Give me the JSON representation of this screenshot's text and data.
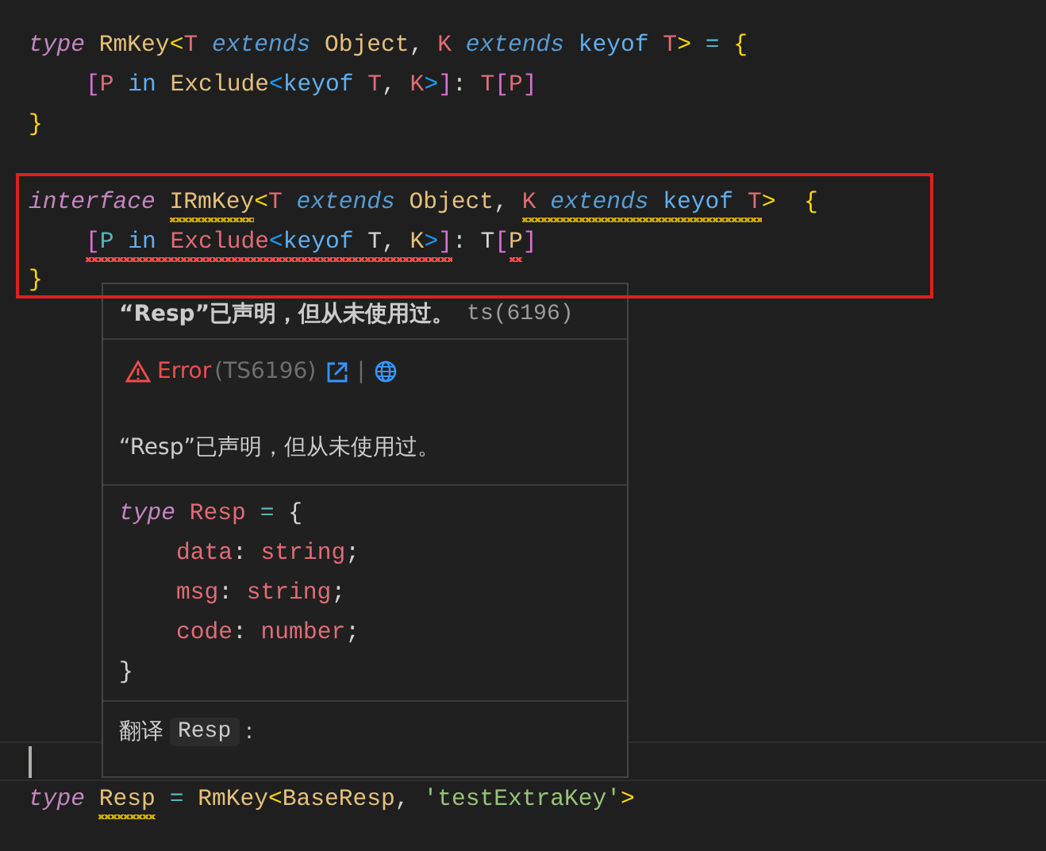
{
  "code_top": [
    {
      "indented": false,
      "segments": [
        {
          "tokens": [
            {
              "text": "type",
              "kind": "keyword"
            },
            {
              "text": " RmKey",
              "kind": "typename"
            },
            {
              "text": "<",
              "kind": "bracket1"
            },
            {
              "text": "T",
              "kind": "param"
            },
            {
              "text": " extends",
              "kind": "modifier"
            },
            {
              "text": " Object",
              "kind": "typename"
            },
            {
              "text": ",",
              "kind": "plain"
            },
            {
              "text": " K",
              "kind": "param"
            },
            {
              "text": " extends",
              "kind": "modifier"
            },
            {
              "text": " keyof",
              "kind": "keyof"
            },
            {
              "text": " T",
              "kind": "param"
            },
            {
              "text": ">",
              "kind": "bracket1"
            },
            {
              "text": " =",
              "kind": "operator"
            },
            {
              "text": " {",
              "kind": "bracket1"
            }
          ]
        }
      ]
    },
    {
      "indented": true,
      "segments": [
        {
          "tokens": [
            {
              "text": "[",
              "kind": "bracket2"
            },
            {
              "text": "P",
              "kind": "param"
            },
            {
              "text": " in",
              "kind": "keyof"
            },
            {
              "text": " Exclude",
              "kind": "typename"
            },
            {
              "text": "<",
              "kind": "bracket3"
            },
            {
              "text": "keyof",
              "kind": "keyof"
            },
            {
              "text": " T",
              "kind": "param"
            },
            {
              "text": ",",
              "kind": "plain"
            },
            {
              "text": " K",
              "kind": "param"
            },
            {
              "text": ">",
              "kind": "bracket3"
            },
            {
              "text": "]",
              "kind": "bracket2"
            },
            {
              "text": ":",
              "kind": "plain"
            },
            {
              "text": " T",
              "kind": "param"
            },
            {
              "text": "[",
              "kind": "bracket2"
            },
            {
              "text": "P",
              "kind": "param"
            },
            {
              "text": "]",
              "kind": "bracket2"
            }
          ]
        }
      ]
    },
    {
      "indented": false,
      "segments": [
        {
          "tokens": [
            {
              "text": "}",
              "kind": "bracket1"
            }
          ]
        }
      ]
    }
  ],
  "highlighted_code": [
    {
      "indented": false,
      "segments": [
        {
          "tokens": [
            {
              "text": "interface ",
              "kind": "keyword"
            }
          ]
        },
        {
          "warning": true,
          "tokens": [
            {
              "text": "IRmKey",
              "kind": "typename"
            }
          ]
        },
        {
          "tokens": [
            {
              "text": "<",
              "kind": "bracket1"
            },
            {
              "text": "T",
              "kind": "param"
            },
            {
              "text": " extends",
              "kind": "modifier"
            },
            {
              "text": " Object",
              "kind": "typename"
            },
            {
              "text": ", ",
              "kind": "plain"
            }
          ]
        },
        {
          "warning": true,
          "tokens": [
            {
              "text": "K",
              "kind": "param"
            },
            {
              "text": " extends",
              "kind": "modifier"
            },
            {
              "text": " keyof",
              "kind": "keyof"
            },
            {
              "text": " T",
              "kind": "param"
            }
          ]
        },
        {
          "tokens": [
            {
              "text": ">",
              "kind": "bracket1"
            },
            {
              "text": "  {",
              "kind": "bracket1"
            }
          ]
        }
      ]
    },
    {
      "indented": true,
      "segments": [
        {
          "error": true,
          "tokens": [
            {
              "text": "[",
              "kind": "bracket2"
            },
            {
              "text": "P",
              "kind": "operator"
            },
            {
              "text": " in",
              "kind": "keyof"
            },
            {
              "text": " Exclude",
              "kind": "param"
            },
            {
              "text": "<",
              "kind": "bracket3"
            },
            {
              "text": "keyof",
              "kind": "keyof"
            },
            {
              "text": " T",
              "kind": "plain"
            },
            {
              "text": ",",
              "kind": "plain"
            },
            {
              "text": " K",
              "kind": "typename"
            },
            {
              "text": ">",
              "kind": "bracket3"
            },
            {
              "text": "]",
              "kind": "bracket2"
            }
          ]
        },
        {
          "tokens": [
            {
              "text": ":",
              "kind": "plain"
            },
            {
              "text": " T",
              "kind": "plain"
            },
            {
              "text": "[",
              "kind": "bracket2"
            }
          ]
        },
        {
          "error": true,
          "tokens": [
            {
              "text": "P",
              "kind": "typename"
            }
          ]
        },
        {
          "tokens": [
            {
              "text": "]",
              "kind": "bracket2"
            }
          ]
        }
      ]
    },
    {
      "indented": false,
      "segments": [
        {
          "tokens": [
            {
              "text": "}",
              "kind": "bracket1"
            }
          ]
        }
      ]
    }
  ],
  "bottom_lines": [
    {
      "current": true
    },
    {
      "current": false,
      "indented": false,
      "segments": [
        {
          "tokens": [
            {
              "text": "type ",
              "kind": "keyword"
            }
          ]
        },
        {
          "warning": true,
          "tokens": [
            {
              "text": "Resp",
              "kind": "typename"
            }
          ]
        },
        {
          "tokens": [
            {
              "text": " =",
              "kind": "operator"
            },
            {
              "text": " RmKey",
              "kind": "typename"
            },
            {
              "text": "<",
              "kind": "bracket1"
            },
            {
              "text": "BaseResp",
              "kind": "typename"
            },
            {
              "text": ",",
              "kind": "plain"
            },
            {
              "text": " 'testExtraKey'",
              "kind": "string"
            },
            {
              "text": ">",
              "kind": "bracket1"
            }
          ]
        }
      ]
    }
  ],
  "hover": {
    "title": "“Resp”已声明，但从未使用过。",
    "source": "ts(6196)",
    "severity": "Error",
    "error_code": "(TS6196)",
    "separator": "|",
    "message": "“Resp”已声明，但从未使用过。",
    "code_lines": [
      {
        "indented": false,
        "segments": [
          {
            "tokens": [
              {
                "text": "type",
                "kind": "keyword"
              },
              {
                "text": " Resp",
                "kind": "param"
              },
              {
                "text": " =",
                "kind": "operator"
              },
              {
                "text": " {",
                "kind": "plain"
              }
            ]
          }
        ]
      },
      {
        "indented": true,
        "segments": [
          {
            "tokens": [
              {
                "text": "data",
                "kind": "param"
              },
              {
                "text": ":",
                "kind": "plain"
              },
              {
                "text": " string",
                "kind": "param"
              },
              {
                "text": ";",
                "kind": "plain"
              }
            ]
          }
        ]
      },
      {
        "indented": true,
        "segments": [
          {
            "tokens": [
              {
                "text": "msg",
                "kind": "param"
              },
              {
                "text": ":",
                "kind": "plain"
              },
              {
                "text": " string",
                "kind": "param"
              },
              {
                "text": ";",
                "kind": "plain"
              }
            ]
          }
        ]
      },
      {
        "indented": true,
        "segments": [
          {
            "tokens": [
              {
                "text": "code",
                "kind": "param"
              },
              {
                "text": ":",
                "kind": "plain"
              },
              {
                "text": " number",
                "kind": "param"
              },
              {
                "text": ";",
                "kind": "plain"
              }
            ]
          }
        ]
      },
      {
        "indented": false,
        "segments": [
          {
            "tokens": [
              {
                "text": "}",
                "kind": "plain"
              }
            ]
          }
        ]
      }
    ],
    "translate_label": "翻译",
    "translate_term": "Resp",
    "translate_colon": ":"
  }
}
